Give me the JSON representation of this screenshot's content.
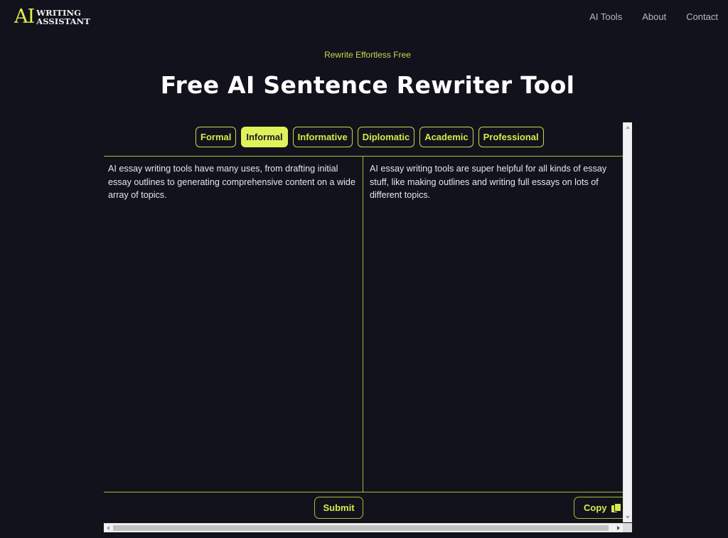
{
  "header": {
    "logo_ai": "AI",
    "logo_line1": "WRITING",
    "logo_line2": "ASSISTANT",
    "nav": [
      {
        "label": "AI Tools"
      },
      {
        "label": "About"
      },
      {
        "label": "Contact"
      }
    ]
  },
  "hero": {
    "subtitle": "Rewrite Effortless Free",
    "title": "Free AI Sentence Rewriter Tool"
  },
  "tool": {
    "tabs": [
      {
        "label": "Formal",
        "active": false
      },
      {
        "label": "Informal",
        "active": true
      },
      {
        "label": "Informative",
        "active": false
      },
      {
        "label": "Diplomatic",
        "active": false
      },
      {
        "label": "Academic",
        "active": false
      },
      {
        "label": "Professional",
        "active": false
      }
    ],
    "input_text": "AI essay writing tools have many uses, from drafting initial essay outlines to generating comprehensive content on a wide array of topics.",
    "output_text": "AI essay writing tools are super helpful for all kinds of essay stuff, like making outlines and writing full essays on lots of different topics.",
    "submit_label": "Submit",
    "copy_label": "Copy",
    "copy_icon": "copy-icon"
  },
  "colors": {
    "background": "#12121c",
    "accent": "#dff25a",
    "accent_text": "#d7ea48",
    "border": "#a9bb3a"
  }
}
